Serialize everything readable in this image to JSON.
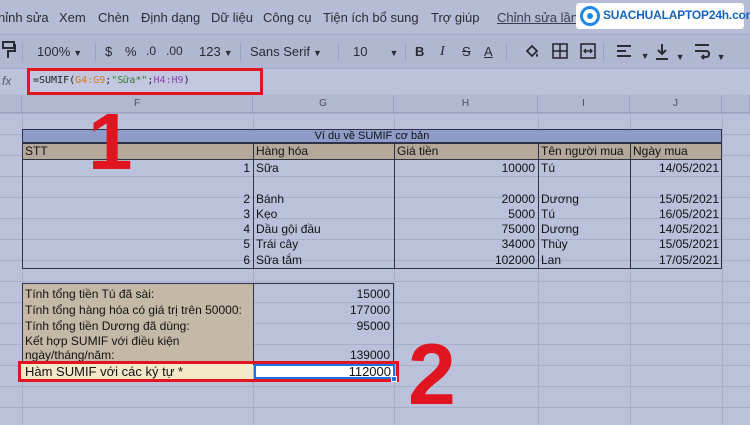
{
  "menu": {
    "items": [
      "hỉnh sửa",
      "Xem",
      "Chèn",
      "Định dạng",
      "Dữ liệu",
      "Công cụ",
      "Tiện ích bổ sung",
      "Trợ giúp",
      "Chỉnh sửa lần c"
    ]
  },
  "logo": {
    "text": "SUACHUALAPTOP24h.com"
  },
  "toolbar": {
    "zoom": "100%",
    "currency": "$",
    "percent": "%",
    "dec_decrease": ".0",
    "dec_increase": ".00",
    "more_formats": "123",
    "font": "Sans Serif",
    "font_size": "10",
    "bold": "B",
    "italic": "I",
    "strike": "S",
    "text_color": "A"
  },
  "formula_bar": {
    "fx": "fx",
    "prefix": "=SUMIF(",
    "range1": "G4:G9",
    "sep1": ";",
    "criteria": "\"Sữa*\"",
    "sep2": ";",
    "range2": "H4:H9",
    "suffix": ")"
  },
  "columns": [
    "F",
    "G",
    "H",
    "I",
    "J"
  ],
  "table": {
    "title": "Ví dụ về SUMIF cơ bản",
    "headers": [
      "STT",
      "Hàng hóa",
      "Giá tiền",
      "Tên người mua",
      "Ngày mua"
    ],
    "rows": [
      [
        "1",
        "Sữa",
        "10000",
        "Tú",
        "14/05/2021"
      ],
      [
        "2",
        "Bánh",
        "20000",
        "Dương",
        "15/05/2021"
      ],
      [
        "3",
        "Kẹo",
        "5000",
        "Tú",
        "16/05/2021"
      ],
      [
        "4",
        "Dầu gội đầu",
        "75000",
        "Dương",
        "14/05/2021"
      ],
      [
        "5",
        "Trái cây",
        "34000",
        "Thùy",
        "15/05/2021"
      ],
      [
        "6",
        "Sữa tắm",
        "102000",
        "Lan",
        "17/05/2021"
      ]
    ]
  },
  "summary": {
    "rows": [
      {
        "label": "Tính tổng tiền Tú đã sài:",
        "value": "15000"
      },
      {
        "label": "Tính tổng hàng hóa có giá trị trên 50000:",
        "value": "177000"
      },
      {
        "label": "Tính tổng tiền Dương đã dùng:",
        "value": "95000"
      },
      {
        "label_line1": "Kết hợp SUMIF với điều kiện",
        "label_line2": "ngày/tháng/năm:",
        "value": "139000"
      }
    ],
    "highlight": {
      "label": "Hàm SUMIF với các ký tự *",
      "value": "112000"
    }
  },
  "annotations": {
    "one": "1",
    "two": "2"
  },
  "colors": {
    "highlight_red": "#e0151f",
    "title_fill": "#8d9cc8",
    "header_fill": "#b4a89b",
    "selection_blue": "#1a73e8"
  }
}
